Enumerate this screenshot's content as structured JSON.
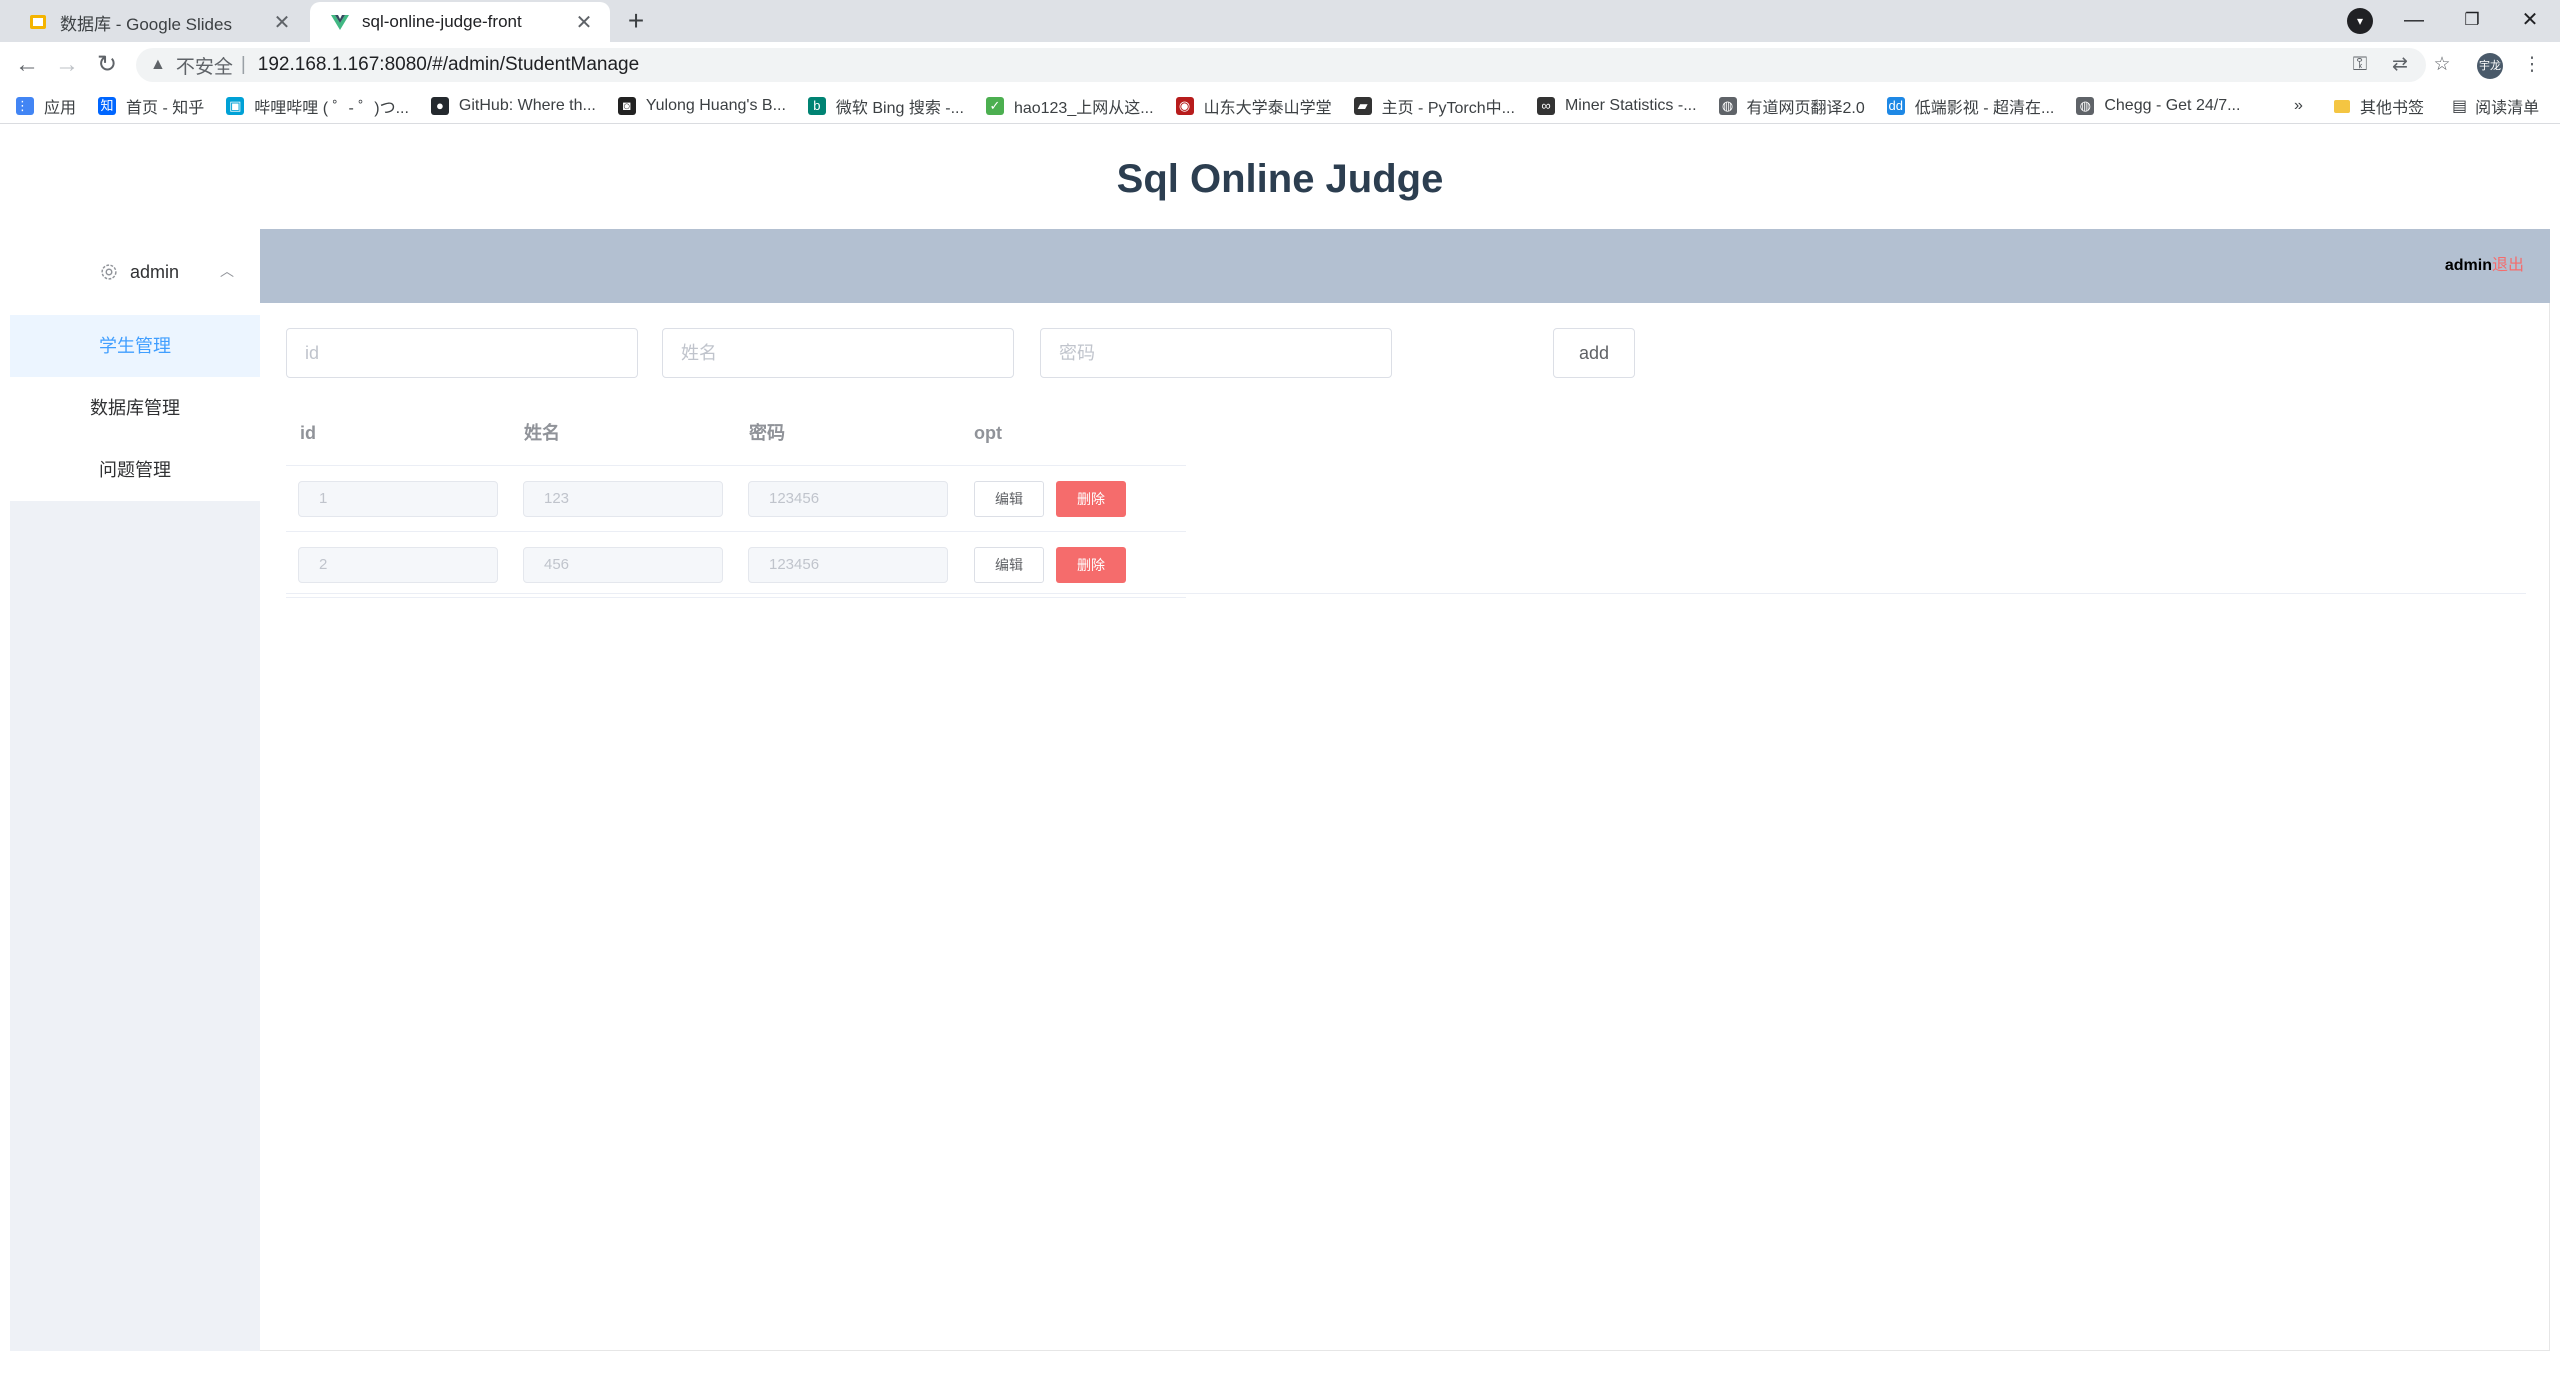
{
  "browser": {
    "tabs": [
      {
        "title": "数据库 - Google Slides",
        "active": false,
        "icon": "slides-icon"
      },
      {
        "title": "sql-online-judge-front",
        "active": true,
        "icon": "vue-icon"
      }
    ],
    "address": {
      "security_label": "不安全",
      "separator": "|",
      "url": "192.168.1.167:8080/#/admin/StudentManage"
    },
    "profile_initials": "宇龙",
    "bookmarks": [
      {
        "label": "应用",
        "icon": "apps-grid-icon",
        "color": "#4285f4"
      },
      {
        "label": "首页 - 知乎",
        "icon": "zhihu-icon",
        "color": "#0066ff"
      },
      {
        "label": "哔哩哔哩 ( ゜- ゜)つ...",
        "icon": "bilibili-icon",
        "color": "#00a1d6"
      },
      {
        "label": "GitHub: Where th...",
        "icon": "github-icon",
        "color": "#24292e"
      },
      {
        "label": "Yulong Huang's B...",
        "icon": "blog-icon",
        "color": "#222222"
      },
      {
        "label": "微软 Bing 搜索 -...",
        "icon": "bing-icon",
        "color": "#008373"
      },
      {
        "label": "hao123_上网从这...",
        "icon": "hao123-icon",
        "color": "#4caf50"
      },
      {
        "label": "山东大学泰山学堂",
        "icon": "sdu-icon",
        "color": "#b71c1c"
      },
      {
        "label": "主页 - PyTorch中...",
        "icon": "pytorch-icon",
        "color": "#333333"
      },
      {
        "label": "Miner Statistics -...",
        "icon": "miner-icon",
        "color": "#333333"
      },
      {
        "label": "有道网页翻译2.0",
        "icon": "globe-icon",
        "color": "#5f6368"
      },
      {
        "label": "低端影视 - 超清在...",
        "icon": "ddrk-icon",
        "color": "#1e88e5"
      },
      {
        "label": "Chegg - Get 24/7...",
        "icon": "globe-icon",
        "color": "#5f6368"
      }
    ],
    "overflow": "»",
    "other_bookmarks": "其他书签",
    "reading_list": "阅读清单"
  },
  "app": {
    "title": "Sql Online Judge",
    "sidebar": {
      "user": "admin",
      "items": [
        {
          "label": "学生管理",
          "active": true
        },
        {
          "label": "数据库管理",
          "active": false
        },
        {
          "label": "问题管理",
          "active": false
        }
      ]
    },
    "header": {
      "user": "admin",
      "logout": "退出"
    },
    "form": {
      "id_placeholder": "id",
      "name_placeholder": "姓名",
      "password_placeholder": "密码",
      "add_label": "add"
    },
    "table": {
      "columns": [
        "id",
        "姓名",
        "密码",
        "opt"
      ],
      "rows": [
        {
          "id": "1",
          "name": "123",
          "password": "123456"
        },
        {
          "id": "2",
          "name": "456",
          "password": "123456"
        }
      ],
      "edit_label": "编辑",
      "delete_label": "删除"
    },
    "colors": {
      "accent": "#409eff",
      "danger": "#f56c6c",
      "header_bg": "#b3c0d1",
      "sidebar_bg": "#eef1f6"
    }
  }
}
